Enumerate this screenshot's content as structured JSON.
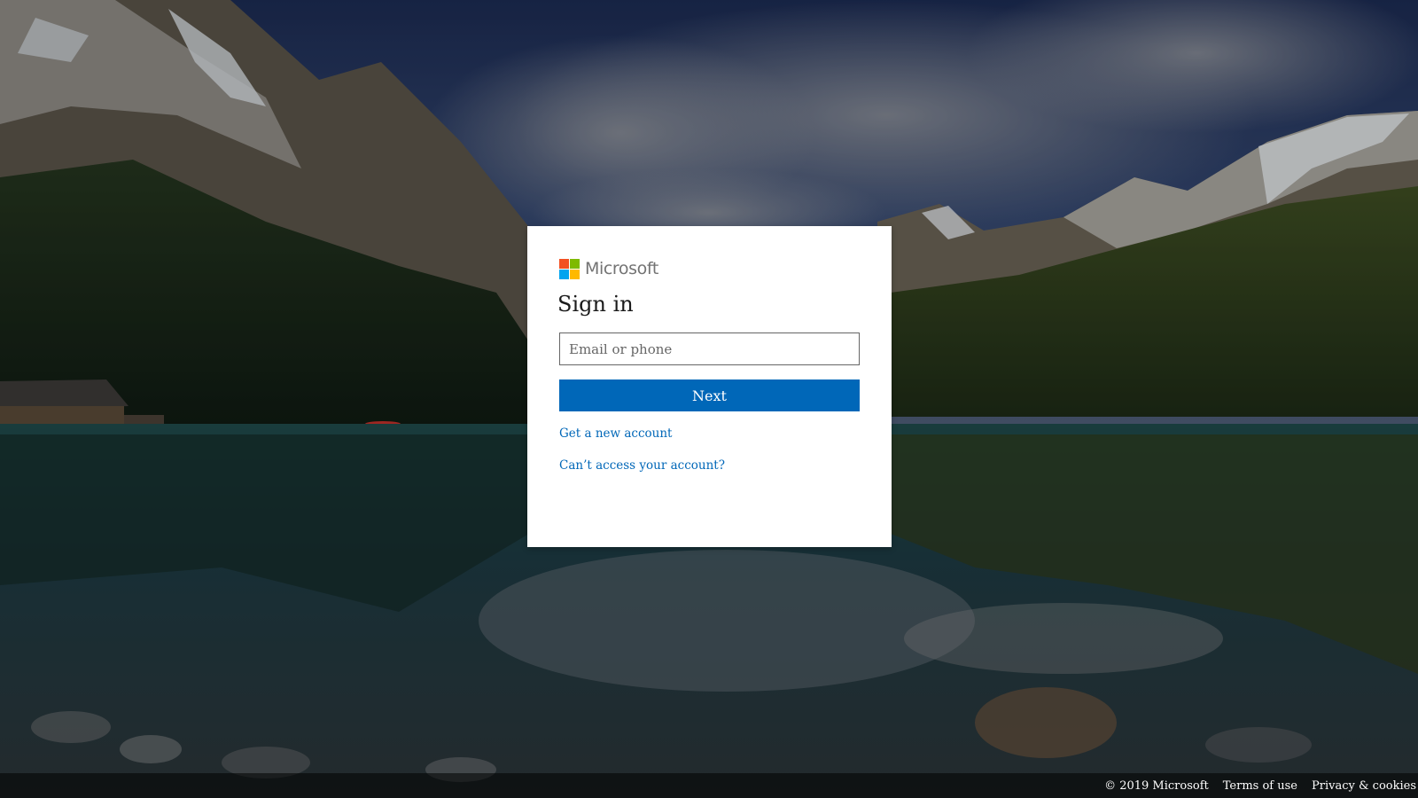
{
  "card": {
    "logo_text": "Microsoft",
    "title": "Sign in",
    "email_placeholder": "Email or phone",
    "email_value": "",
    "next_label": "Next",
    "link_new_account": "Get a new account",
    "link_cant_access": "Can’t access your account?"
  },
  "footer": {
    "copyright": "© 2019 Microsoft",
    "terms": "Terms of use",
    "privacy": "Privacy & cookies"
  },
  "colors": {
    "accent": "#0067b8",
    "logo_red": "#f25022",
    "logo_green": "#7fba00",
    "logo_blue": "#00a4ef",
    "logo_yellow": "#ffb900"
  },
  "icons": {
    "logo": "microsoft-logo-icon"
  }
}
